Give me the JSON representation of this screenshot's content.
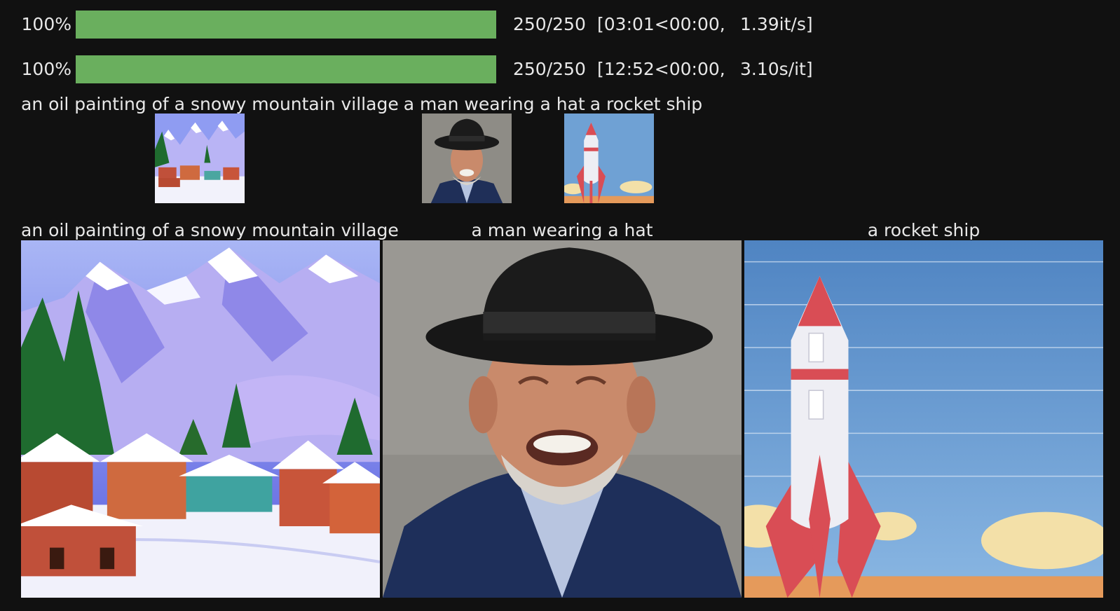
{
  "progress_bars": [
    {
      "percent_label": "100%",
      "fraction": 1.0,
      "count": "250/250",
      "time": "[03:01<00:00,",
      "rate": "1.39it/s]"
    },
    {
      "percent_label": "100%",
      "fraction": 1.0,
      "count": "250/250",
      "time": "[12:52<00:00,",
      "rate": "3.10s/it]"
    }
  ],
  "prompts": [
    "an oil painting of a snowy mountain village",
    "a man wearing a hat",
    "a rocket ship"
  ],
  "images": [
    {
      "icon": "mountain-village-painting",
      "colors": {
        "sky": "#7f8ff0",
        "snow": "#f4f4ff",
        "tree": "#1f6b2f",
        "house": "#c8553a"
      }
    },
    {
      "icon": "man-with-hat-photo",
      "colors": {
        "bg": "#8b8b86",
        "hat": "#1b1b1b",
        "jacket": "#1e2f5a",
        "skin": "#c98a6b"
      }
    },
    {
      "icon": "rocket-ship-illustration",
      "colors": {
        "sky": "#6fa1d4",
        "rocket": "#d94d55",
        "body": "#eeeef4",
        "cloud": "#f3e0a8",
        "ground": "#e59a5b"
      }
    }
  ]
}
